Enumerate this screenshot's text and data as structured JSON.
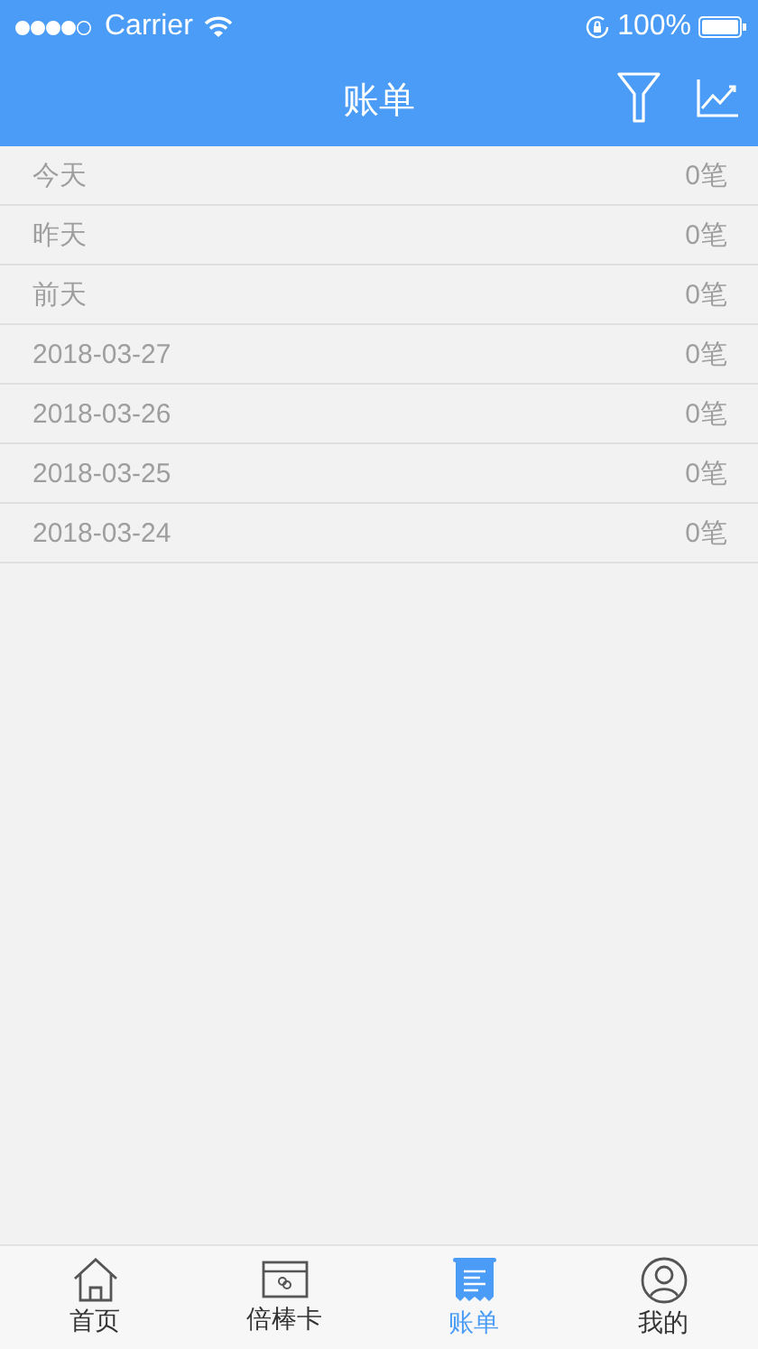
{
  "status_bar": {
    "carrier": "Carrier",
    "battery": "100%"
  },
  "nav_bar": {
    "title": "账单"
  },
  "rows": [
    {
      "date": "今天",
      "count": "0笔"
    },
    {
      "date": "昨天",
      "count": "0笔"
    },
    {
      "date": "前天",
      "count": "0笔"
    },
    {
      "date": "2018-03-27",
      "count": "0笔"
    },
    {
      "date": "2018-03-26",
      "count": "0笔"
    },
    {
      "date": "2018-03-25",
      "count": "0笔"
    },
    {
      "date": "2018-03-24",
      "count": "0笔"
    }
  ],
  "tab_bar": [
    {
      "label": "首页",
      "kind": "home",
      "selected": false
    },
    {
      "label": "倍棒卡",
      "kind": "card",
      "selected": false
    },
    {
      "label": "账单",
      "kind": "bill",
      "selected": true
    },
    {
      "label": "我的",
      "kind": "profile",
      "selected": false
    }
  ]
}
